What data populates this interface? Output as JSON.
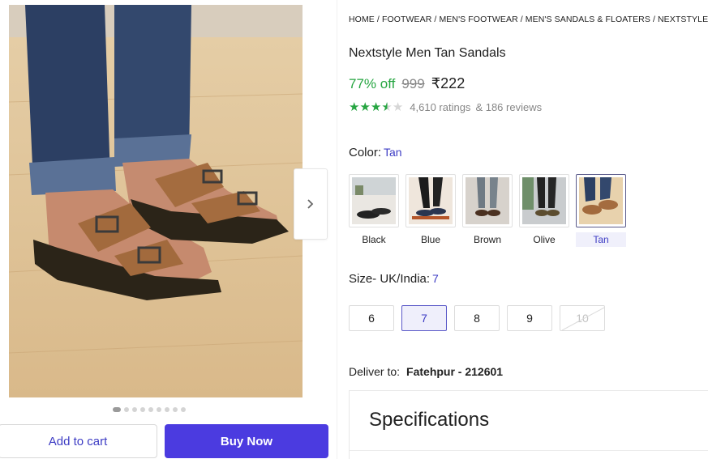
{
  "product": {
    "breadcrumb": [
      "HOME",
      "FOOTWEAR",
      "MEN'S FOOTWEAR",
      "MEN'S SANDALS & FLOATERS",
      "NEXTSTYLE MEN'S"
    ],
    "title": "Nextstyle Men Tan Sandals",
    "discount": "77% off",
    "mrp": "999",
    "price": "₹222",
    "rating_stars": 3.5,
    "ratings_count": "4,610 ratings",
    "reviews_count": "& 186 reviews"
  },
  "color": {
    "label": "Color:",
    "selected": "Tan",
    "options": [
      "Black",
      "Blue",
      "Brown",
      "Olive",
      "Tan"
    ]
  },
  "size": {
    "label": "Size- UK/India:",
    "selected": "7",
    "options": [
      "6",
      "7",
      "8",
      "9",
      "10"
    ],
    "unavailable": [
      "10"
    ]
  },
  "gallery": {
    "total_images": 9,
    "active_index": 0,
    "next_icon": "chevron-right-icon"
  },
  "actions": {
    "add_to_cart": "Add to cart",
    "buy_now": "Buy Now"
  },
  "delivery": {
    "label": "Deliver to:",
    "location": "Fatehpur - 212601"
  },
  "specifications": {
    "title": "Specifications"
  },
  "colors": {
    "accent": "#4b3be0",
    "link": "#3d3cc4",
    "discount_green": "#26a541",
    "star_green": "#26a541"
  }
}
